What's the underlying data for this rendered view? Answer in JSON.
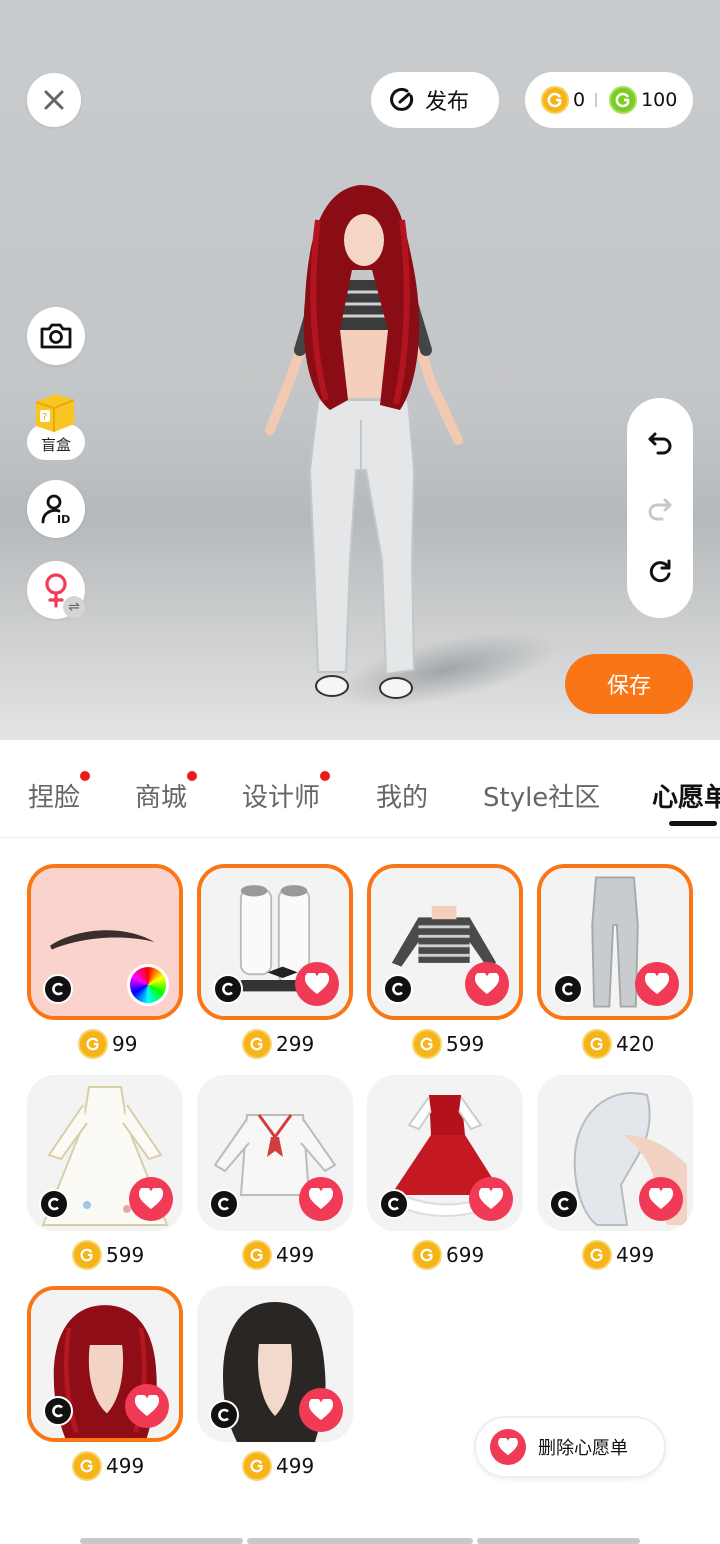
{
  "header": {
    "publish_label": "发布",
    "gold_coins": "0",
    "green_coins": "100"
  },
  "side": {
    "blind_box_label": "盲盒"
  },
  "save_label": "保存",
  "tabs": [
    {
      "label": "捏脸",
      "dot": true
    },
    {
      "label": "商城",
      "dot": true
    },
    {
      "label": "设计师",
      "dot": true
    },
    {
      "label": "我的",
      "dot": false
    },
    {
      "label": "Style社区",
      "dot": false
    },
    {
      "label": "心愿单",
      "dot": false,
      "active": true
    }
  ],
  "items": [
    {
      "kind": "eyebrow",
      "price": "99",
      "selected": true
    },
    {
      "kind": "shoes",
      "price": "299",
      "selected": true
    },
    {
      "kind": "striped-top",
      "price": "599",
      "selected": true
    },
    {
      "kind": "pants",
      "price": "420",
      "selected": true
    },
    {
      "kind": "white-gown",
      "price": "599",
      "selected": false
    },
    {
      "kind": "sailor-jacket",
      "price": "499",
      "selected": false
    },
    {
      "kind": "red-dress",
      "price": "699",
      "selected": false
    },
    {
      "kind": "silver-hair",
      "price": "499",
      "selected": false
    },
    {
      "kind": "red-hair",
      "price": "499",
      "selected": true
    },
    {
      "kind": "black-hair",
      "price": "499",
      "selected": false
    }
  ],
  "delete_wishlist_label": "删除心愿单",
  "colors": {
    "accent": "#f97516",
    "heart": "#f03a56",
    "coin_gold": "#f4b41a",
    "coin_green": "#7ccc25"
  }
}
